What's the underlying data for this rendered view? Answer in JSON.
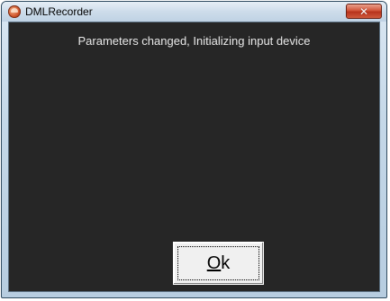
{
  "window": {
    "title": "DMLRecorder",
    "app_icon": "dmlrecorder-app-icon",
    "close_glyph": "✕"
  },
  "dialog": {
    "message": "Parameters changed, Initializing input device",
    "ok_button": {
      "mnemonic": "O",
      "rest": "k"
    }
  },
  "colors": {
    "client_background": "#262626",
    "message_text": "#e8e8e8",
    "close_button": "#c9432a"
  }
}
